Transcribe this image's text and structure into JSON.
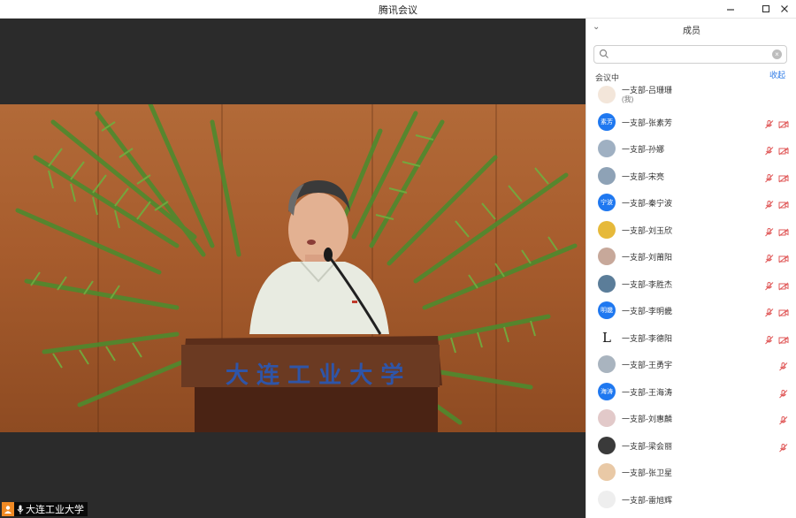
{
  "window": {
    "title": "腾讯会议"
  },
  "video": {
    "label": "大连工业大学",
    "podium_text": "大 连 工 业 大 学"
  },
  "sidebar": {
    "title": "成员",
    "search": {
      "placeholder": ""
    },
    "section_label": "会议中",
    "collapse_label": "收起",
    "members": [
      {
        "name": "一支部-吕珊珊",
        "sub": "(我)",
        "avatar_text": "",
        "avatar_color": "#f3e6da",
        "mic": false,
        "cam": false
      },
      {
        "name": "一支部-张素芳",
        "sub": "",
        "avatar_text": "素芳",
        "avatar_color": "#1f78f0",
        "mic": true,
        "cam": true
      },
      {
        "name": "一支部-孙娜",
        "sub": "",
        "avatar_text": "",
        "avatar_color": "#9fb0c2",
        "mic": true,
        "cam": true
      },
      {
        "name": "一支部-宋亮",
        "sub": "",
        "avatar_text": "",
        "avatar_color": "#8ea2b6",
        "mic": true,
        "cam": true
      },
      {
        "name": "一支部-秦宁波",
        "sub": "",
        "avatar_text": "宁波",
        "avatar_color": "#1f78f0",
        "mic": true,
        "cam": true
      },
      {
        "name": "一支部-刘玉欣",
        "sub": "",
        "avatar_text": "",
        "avatar_color": "#e6b93a",
        "mic": true,
        "cam": true
      },
      {
        "name": "一支部-刘莆阳",
        "sub": "",
        "avatar_text": "",
        "avatar_color": "#c7a89a",
        "mic": true,
        "cam": true
      },
      {
        "name": "一支部-李胜杰",
        "sub": "",
        "avatar_text": "",
        "avatar_color": "#5b7d99",
        "mic": true,
        "cam": true
      },
      {
        "name": "一支部-李明畿",
        "sub": "",
        "avatar_text": "明畿",
        "avatar_color": "#1f78f0",
        "mic": true,
        "cam": true
      },
      {
        "name": "一支部-李德阳",
        "sub": "",
        "avatar_text": "L",
        "avatar_color": "#ffffff",
        "mic": true,
        "cam": true
      },
      {
        "name": "一支部-王勇宇",
        "sub": "",
        "avatar_text": "",
        "avatar_color": "#a9b4bf",
        "mic": true,
        "cam": false
      },
      {
        "name": "一支部-王海涛",
        "sub": "",
        "avatar_text": "海涛",
        "avatar_color": "#1f78f0",
        "mic": true,
        "cam": false
      },
      {
        "name": "一支部-刘惠麟",
        "sub": "",
        "avatar_text": "",
        "avatar_color": "#e2c9c9",
        "mic": true,
        "cam": false
      },
      {
        "name": "一支部-梁会丽",
        "sub": "",
        "avatar_text": "",
        "avatar_color": "#3a3a3a",
        "mic": true,
        "cam": false
      },
      {
        "name": "一支部-张卫星",
        "sub": "",
        "avatar_text": "",
        "avatar_color": "#e9c9a6",
        "mic": false,
        "cam": false
      },
      {
        "name": "一支部-雷旭辉",
        "sub": "",
        "avatar_text": "",
        "avatar_color": "#eeeeee",
        "mic": false,
        "cam": false
      }
    ]
  }
}
